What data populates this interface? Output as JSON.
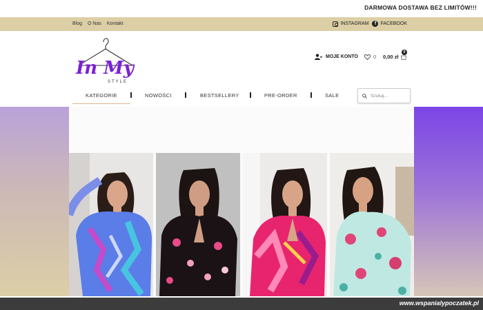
{
  "promo": {
    "text": "DARMOWA DOSTAWA BEZ LIMITÓW!!!"
  },
  "top_links": [
    "Blog",
    "O Nas",
    "Kontakt"
  ],
  "social": {
    "instagram": "INSTAGRAM",
    "facebook": "FACEBOOK"
  },
  "logo": {
    "text": "In My",
    "sub": "STYLE",
    "accent": "#7a1fd6"
  },
  "header": {
    "account_label": "MOJE KONTO",
    "wishlist_count": "0",
    "cart_total": "0,00 zł",
    "cart_count": "0"
  },
  "nav": {
    "items": [
      "KATEGORIE",
      "NOWOŚCI",
      "BESTSELLERY",
      "PRE-ORDER",
      "SALE"
    ],
    "search_placeholder": "Szukaj..."
  },
  "hero": {
    "photos": [
      {
        "icon": "woman-blue-print-dress"
      },
      {
        "icon": "woman-black-floral-dress"
      },
      {
        "icon": "woman-pink-print-dress"
      },
      {
        "icon": "woman-mint-floral-dress"
      }
    ]
  },
  "watermark": "www.wspanialypoczatek.pl",
  "colors": {
    "top_bar": "#dccfa6",
    "footer": "#3c3c3c",
    "brand": "#7a1fd6"
  }
}
